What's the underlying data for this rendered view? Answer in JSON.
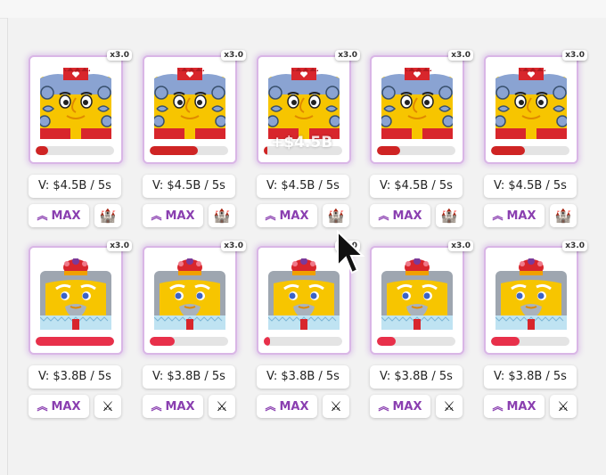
{
  "colors": {
    "accent": "#8a3fb0",
    "bar_row1": "#cf2424",
    "bar_row2": "#e8304a",
    "card_glow": "#d9b6e6"
  },
  "rows": [
    {
      "portrait": "king-red-crown",
      "icon": "castle-icon",
      "icon_glyph": "🏰",
      "bar_color": "#cf2424",
      "units": [
        {
          "multiplier": "x3.0",
          "progress": 0.16,
          "value": "V: $4.5B / 5s",
          "max_label": "MAX"
        },
        {
          "multiplier": "x3.0",
          "progress": 0.61,
          "value": "V: $4.5B / 5s",
          "max_label": "MAX"
        },
        {
          "multiplier": "x3.0",
          "progress": 0.04,
          "value": "V: $4.5B / 5s",
          "max_label": "MAX",
          "popup": "+$4.5B"
        },
        {
          "multiplier": "x3.0",
          "progress": 0.3,
          "value": "V: $4.5B / 5s",
          "max_label": "MAX"
        },
        {
          "multiplier": "x3.0",
          "progress": 0.43,
          "value": "V: $4.5B / 5s",
          "max_label": "MAX"
        }
      ]
    },
    {
      "portrait": "king-gray-jeweled-crown",
      "icon": "crossed-swords-icon",
      "icon_glyph": "⚔",
      "bar_color": "#e8304a",
      "units": [
        {
          "multiplier": "x3.0",
          "progress": 1.0,
          "value": "V: $3.8B / 5s",
          "max_label": "MAX"
        },
        {
          "multiplier": "x3.0",
          "progress": 0.32,
          "value": "V: $3.8B / 5s",
          "max_label": "MAX"
        },
        {
          "multiplier": "x3.0",
          "progress": 0.08,
          "value": "V: $3.8B / 5s",
          "max_label": "MAX"
        },
        {
          "multiplier": "x3.0",
          "progress": 0.24,
          "value": "V: $3.8B / 5s",
          "max_label": "MAX"
        },
        {
          "multiplier": "x3.0",
          "progress": 0.36,
          "value": "V: $3.8B / 5s",
          "max_label": "MAX"
        }
      ]
    }
  ],
  "max_chevron": "«"
}
